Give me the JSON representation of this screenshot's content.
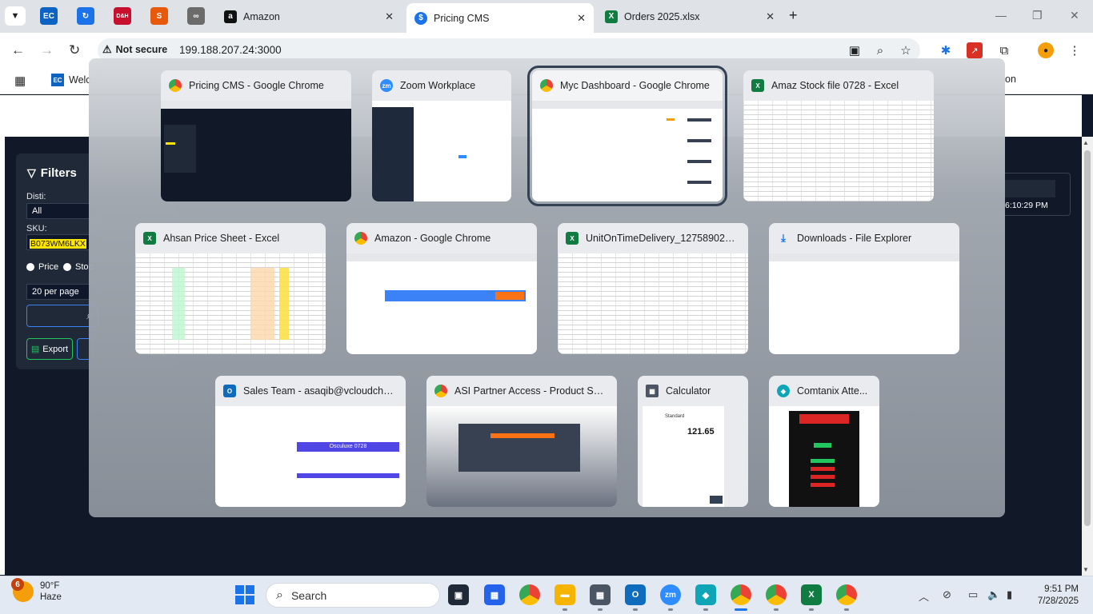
{
  "browser": {
    "pinned_tabs": [
      {
        "icon": "ec-icon",
        "color": "#0c63c4"
      },
      {
        "icon": "sync-icon",
        "color": "#1a73e8"
      },
      {
        "icon": "dh-icon",
        "color": "#c8102e",
        "text": "D&H"
      },
      {
        "icon": "s-icon",
        "color": "#e8590c"
      },
      {
        "icon": "binoculars-icon",
        "color": "#555555"
      }
    ],
    "tabs": [
      {
        "title": "Amazon",
        "icon": "amazon-icon",
        "active": false
      },
      {
        "title": "Pricing CMS",
        "icon": "dollar-icon",
        "active": true
      },
      {
        "title": "Orders 2025.xlsx",
        "icon": "excel-icon",
        "active": false
      }
    ],
    "security_label": "Not secure",
    "url": "199.188.207.24:3000",
    "bookmarks": {
      "first_label": "Welc",
      "last_label": "on"
    }
  },
  "page": {
    "filters_title": "Filters",
    "disti_label": "Disti:",
    "disti_value": "All",
    "sku_label": "SKU:",
    "sku_value": "B073WM6LKX",
    "radio_price": "Price",
    "radio_stock": "Stoc",
    "per_page": "20 per page",
    "export_label": "Export",
    "timestamp": "6:10:29 PM"
  },
  "switcher": {
    "windows": [
      {
        "title": "Pricing CMS - Google Chrome",
        "app": "chrome",
        "selected": false
      },
      {
        "title": "Zoom Workplace",
        "app": "zoom",
        "selected": false
      },
      {
        "title": "Myc Dashboard - Google Chrome",
        "app": "chrome",
        "selected": true
      },
      {
        "title": "Amaz Stock file 0728 - Excel",
        "app": "excel",
        "selected": false
      },
      {
        "title": "Ahsan Price Sheet - Excel",
        "app": "excel",
        "selected": false
      },
      {
        "title": "Amazon - Google Chrome",
        "app": "chrome",
        "selected": false
      },
      {
        "title": "UnitOnTimeDelivery_1275890202...",
        "app": "excel",
        "selected": false
      },
      {
        "title": "Downloads - File Explorer",
        "app": "explorer",
        "selected": false
      },
      {
        "title": "Sales Team - asaqib@vcloudchoic...",
        "app": "outlook",
        "selected": false
      },
      {
        "title": "ASI Partner Access - Product Sear...",
        "app": "chrome",
        "selected": false
      },
      {
        "title": "Calculator",
        "app": "calculator",
        "selected": false
      },
      {
        "title": "Comtanix Atte...",
        "app": "comtanix",
        "selected": false
      }
    ],
    "calculator_display": "121.65",
    "calculator_mode": "Standard",
    "outlook_banner": "Osculuxe 0728"
  },
  "taskbar": {
    "weather_badge": "6",
    "temperature": "90°F",
    "condition": "Haze",
    "search_placeholder": "Search",
    "time": "9:51 PM",
    "date": "7/28/2025"
  },
  "colors": {
    "chrome_blue": "#1a73e8",
    "excel_green": "#107c41",
    "zoom_blue": "#2d8cff",
    "outlook_blue": "#0f6cbd",
    "page_dark": "#111827"
  }
}
